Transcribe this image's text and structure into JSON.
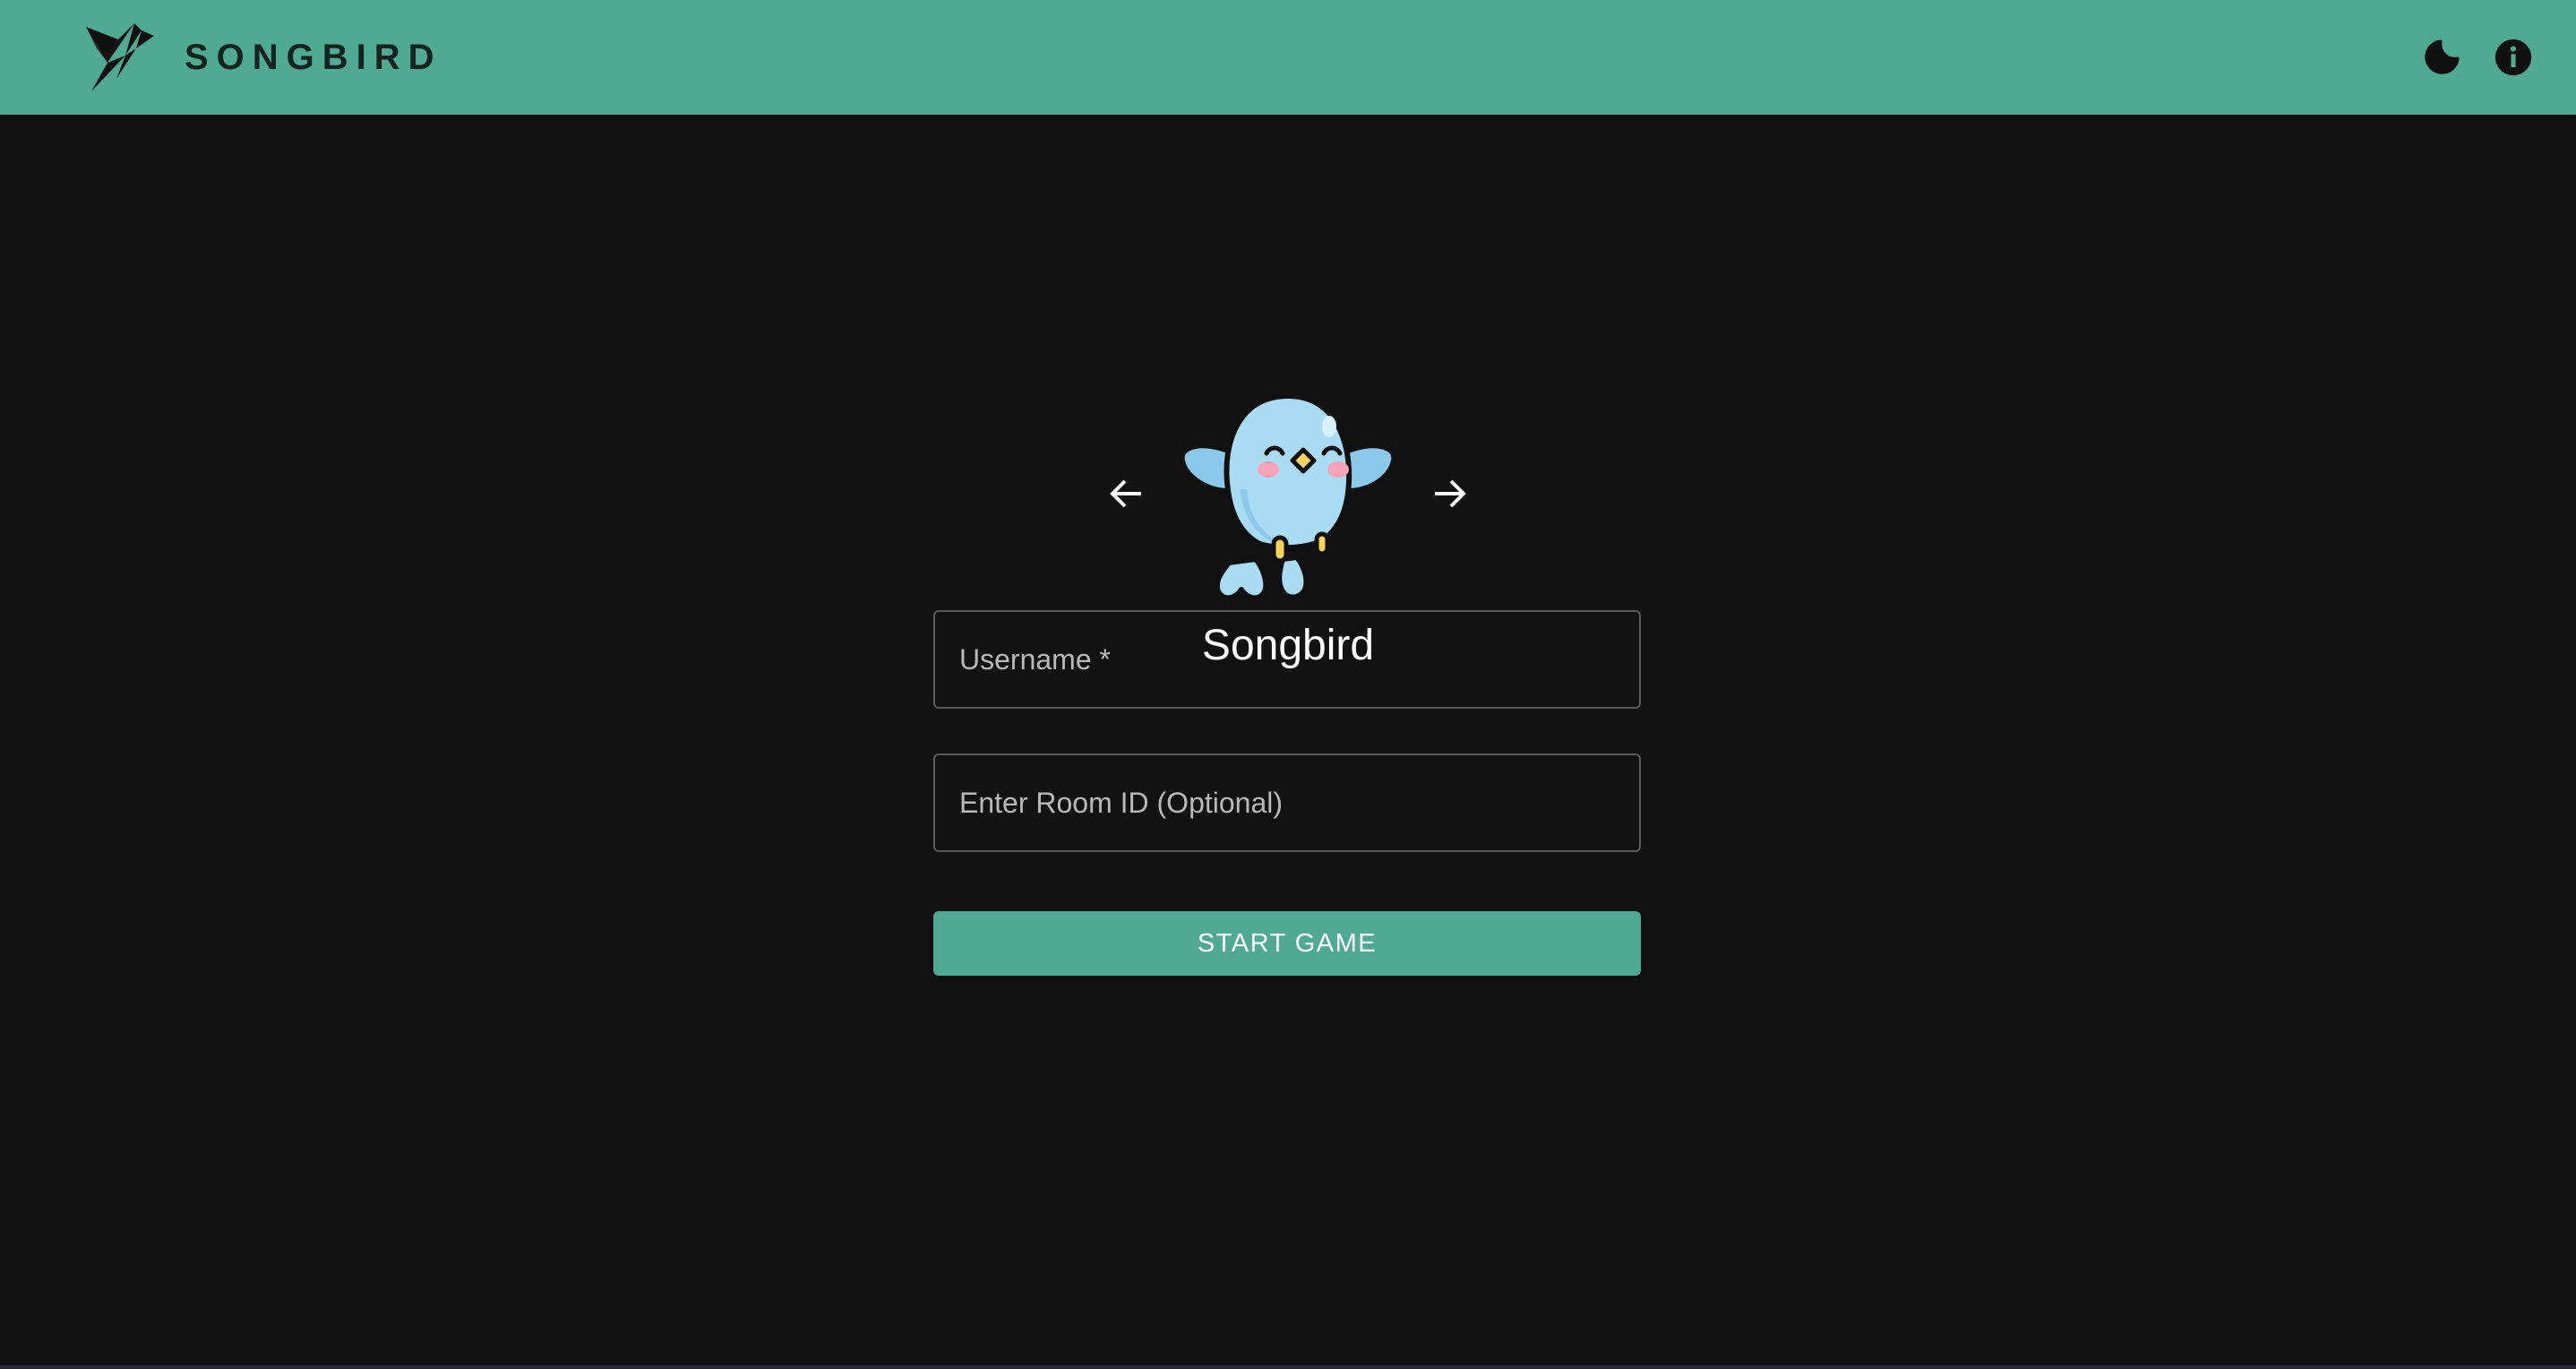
{
  "header": {
    "brand_name": "SONGBIRD",
    "logo_icon": "origami-bird-icon",
    "actions": [
      {
        "icon": "moon-icon",
        "purpose": "toggle-dark-mode"
      },
      {
        "icon": "info-icon",
        "purpose": "about"
      }
    ],
    "accent_color": "#4fa993"
  },
  "avatar_picker": {
    "prev_icon": "arrow-left-icon",
    "next_icon": "arrow-right-icon",
    "avatar_icon": "bluebird-avatar-icon",
    "selected_name": "Songbird"
  },
  "form": {
    "username_label": "Username *",
    "room_label": "Enter Room ID (Optional)",
    "start_label": "START GAME"
  },
  "colors": {
    "background": "#121212",
    "field_border": "#5b5b5b",
    "text": "#ffffff"
  }
}
